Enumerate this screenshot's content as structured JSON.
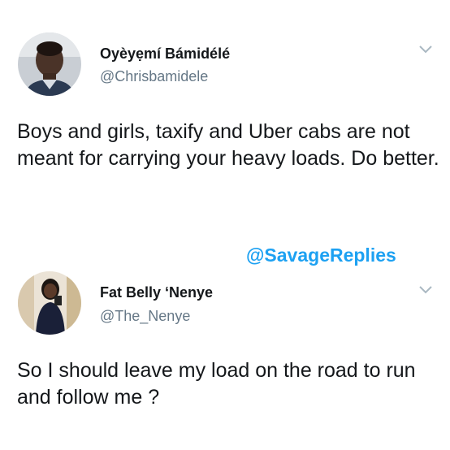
{
  "tweets": [
    {
      "display_name": "Oyèyẹmí Bámidélé",
      "handle": "@Chrisbamidele",
      "text": "Boys and girls, taxify and Uber cabs are not meant for carrying your heavy loads. Do better.",
      "avatar_icon": "avatar-photo-man",
      "menu_icon": "chevron-down-icon"
    },
    {
      "display_name": "Fat Belly ‘Nenye",
      "handle": "@The_Nenye",
      "text": "So I should leave my load on the road to run and follow me ?",
      "avatar_icon": "avatar-photo-woman",
      "menu_icon": "chevron-down-icon"
    }
  ],
  "watermark": "@SavageReplies",
  "colors": {
    "text": "#14171a",
    "handle": "#657786",
    "watermark": "#1da1f2",
    "chevron": "#aab8c2"
  }
}
